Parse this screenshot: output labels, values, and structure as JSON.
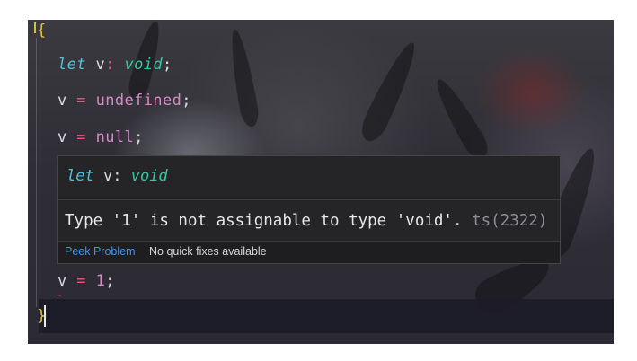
{
  "code": {
    "open_brace": "{",
    "close_brace": "}",
    "line1": {
      "kw": "let",
      "name": "v",
      "colon": ":",
      "type": "void",
      "semi": ";"
    },
    "line2": {
      "name": "v",
      "op": "=",
      "value": "undefined",
      "semi": ";"
    },
    "line3": {
      "name": "v",
      "op": "=",
      "value": "null",
      "semi": ";"
    },
    "line4": {
      "name": "v",
      "op": "=",
      "value": "1",
      "semi": ";"
    }
  },
  "hover": {
    "signature": {
      "kw": "let",
      "name": "v",
      "colon": ":",
      "type": "void"
    },
    "message": "Type '1' is not assignable to type 'void'.",
    "error_code": "ts(2322)",
    "peek_problem": "Peek Problem",
    "no_fixes": "No quick fixes available"
  },
  "colors": {
    "keyword": "#4fc1d7",
    "type": "#34c7a6",
    "operator": "#e9567f",
    "literal": "#d58ac6",
    "brace": "#e2c431",
    "link": "#3794ff"
  }
}
